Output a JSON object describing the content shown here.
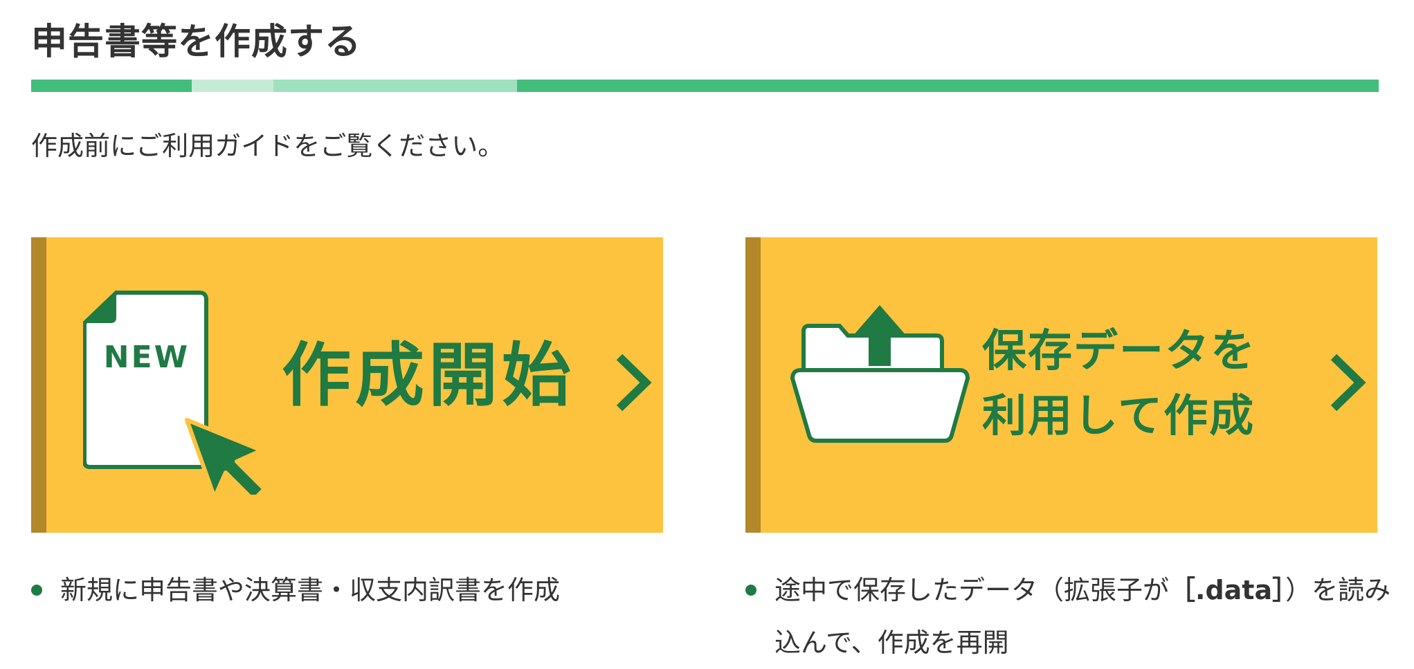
{
  "page": {
    "title": "申告書等を作成する",
    "intro": "作成前にご利用ガイドをご覧ください。"
  },
  "colors": {
    "accent_green": "#43bd7c",
    "dark_green": "#1f7a44",
    "card_yellow": "#fdc33e",
    "card_edge": "#b3882a"
  },
  "cards": {
    "new": {
      "label": "作成開始",
      "icon_text": "NEW",
      "icon": "new-document-cursor-icon",
      "arrow_icon": "chevron-right-icon"
    },
    "saved": {
      "label_line1": "保存データを",
      "label_line2": "利用して作成",
      "icon": "folder-upload-icon",
      "arrow_icon": "chevron-right-icon"
    }
  },
  "descriptions": {
    "new": "新規に申告書や決算書・収支内訳書を作成",
    "saved_prefix": "途中で保存したデータ（拡張子が",
    "saved_ext": "［.data］",
    "saved_suffix": "）を読み込んで、作成を再開"
  }
}
